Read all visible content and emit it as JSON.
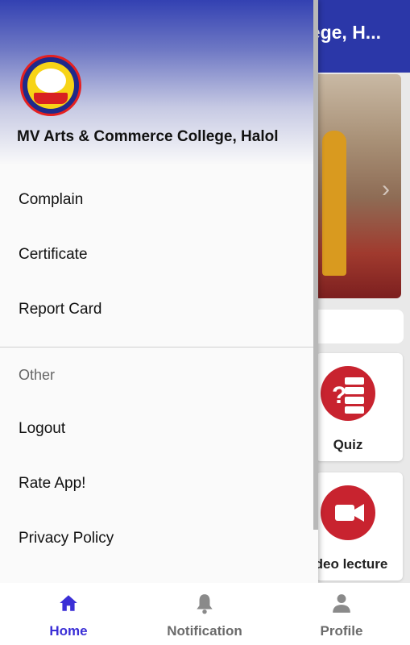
{
  "app": {
    "title": "MV Arts & Commerce College, Halol",
    "visible_title_fragment": "llege, H...",
    "cards": [
      {
        "label": "Quiz",
        "icon": "quiz-icon"
      },
      {
        "label": "Video lecture",
        "visible_label": "deo lecture",
        "icon": "video-camera-icon"
      }
    ]
  },
  "drawer": {
    "college_name": "MV Arts & Commerce College, Halol",
    "items": [
      {
        "label": "Complain"
      },
      {
        "label": "Certificate"
      },
      {
        "label": "Report Card"
      }
    ],
    "section_other": "Other",
    "other_items": [
      {
        "label": "Logout"
      },
      {
        "label": "Rate App!"
      },
      {
        "label": "Privacy Policy"
      }
    ]
  },
  "bottom_nav": {
    "items": [
      {
        "label": "Home",
        "icon": "home-icon",
        "active": true
      },
      {
        "label": "Notification",
        "icon": "bell-icon",
        "active": false
      },
      {
        "label": "Profile",
        "icon": "person-icon",
        "active": false
      }
    ]
  },
  "colors": {
    "primary": "#2b37a8",
    "active_nav": "#3b2fd6",
    "inactive_nav": "#6b6b6b",
    "accent_red": "#c8232f"
  }
}
